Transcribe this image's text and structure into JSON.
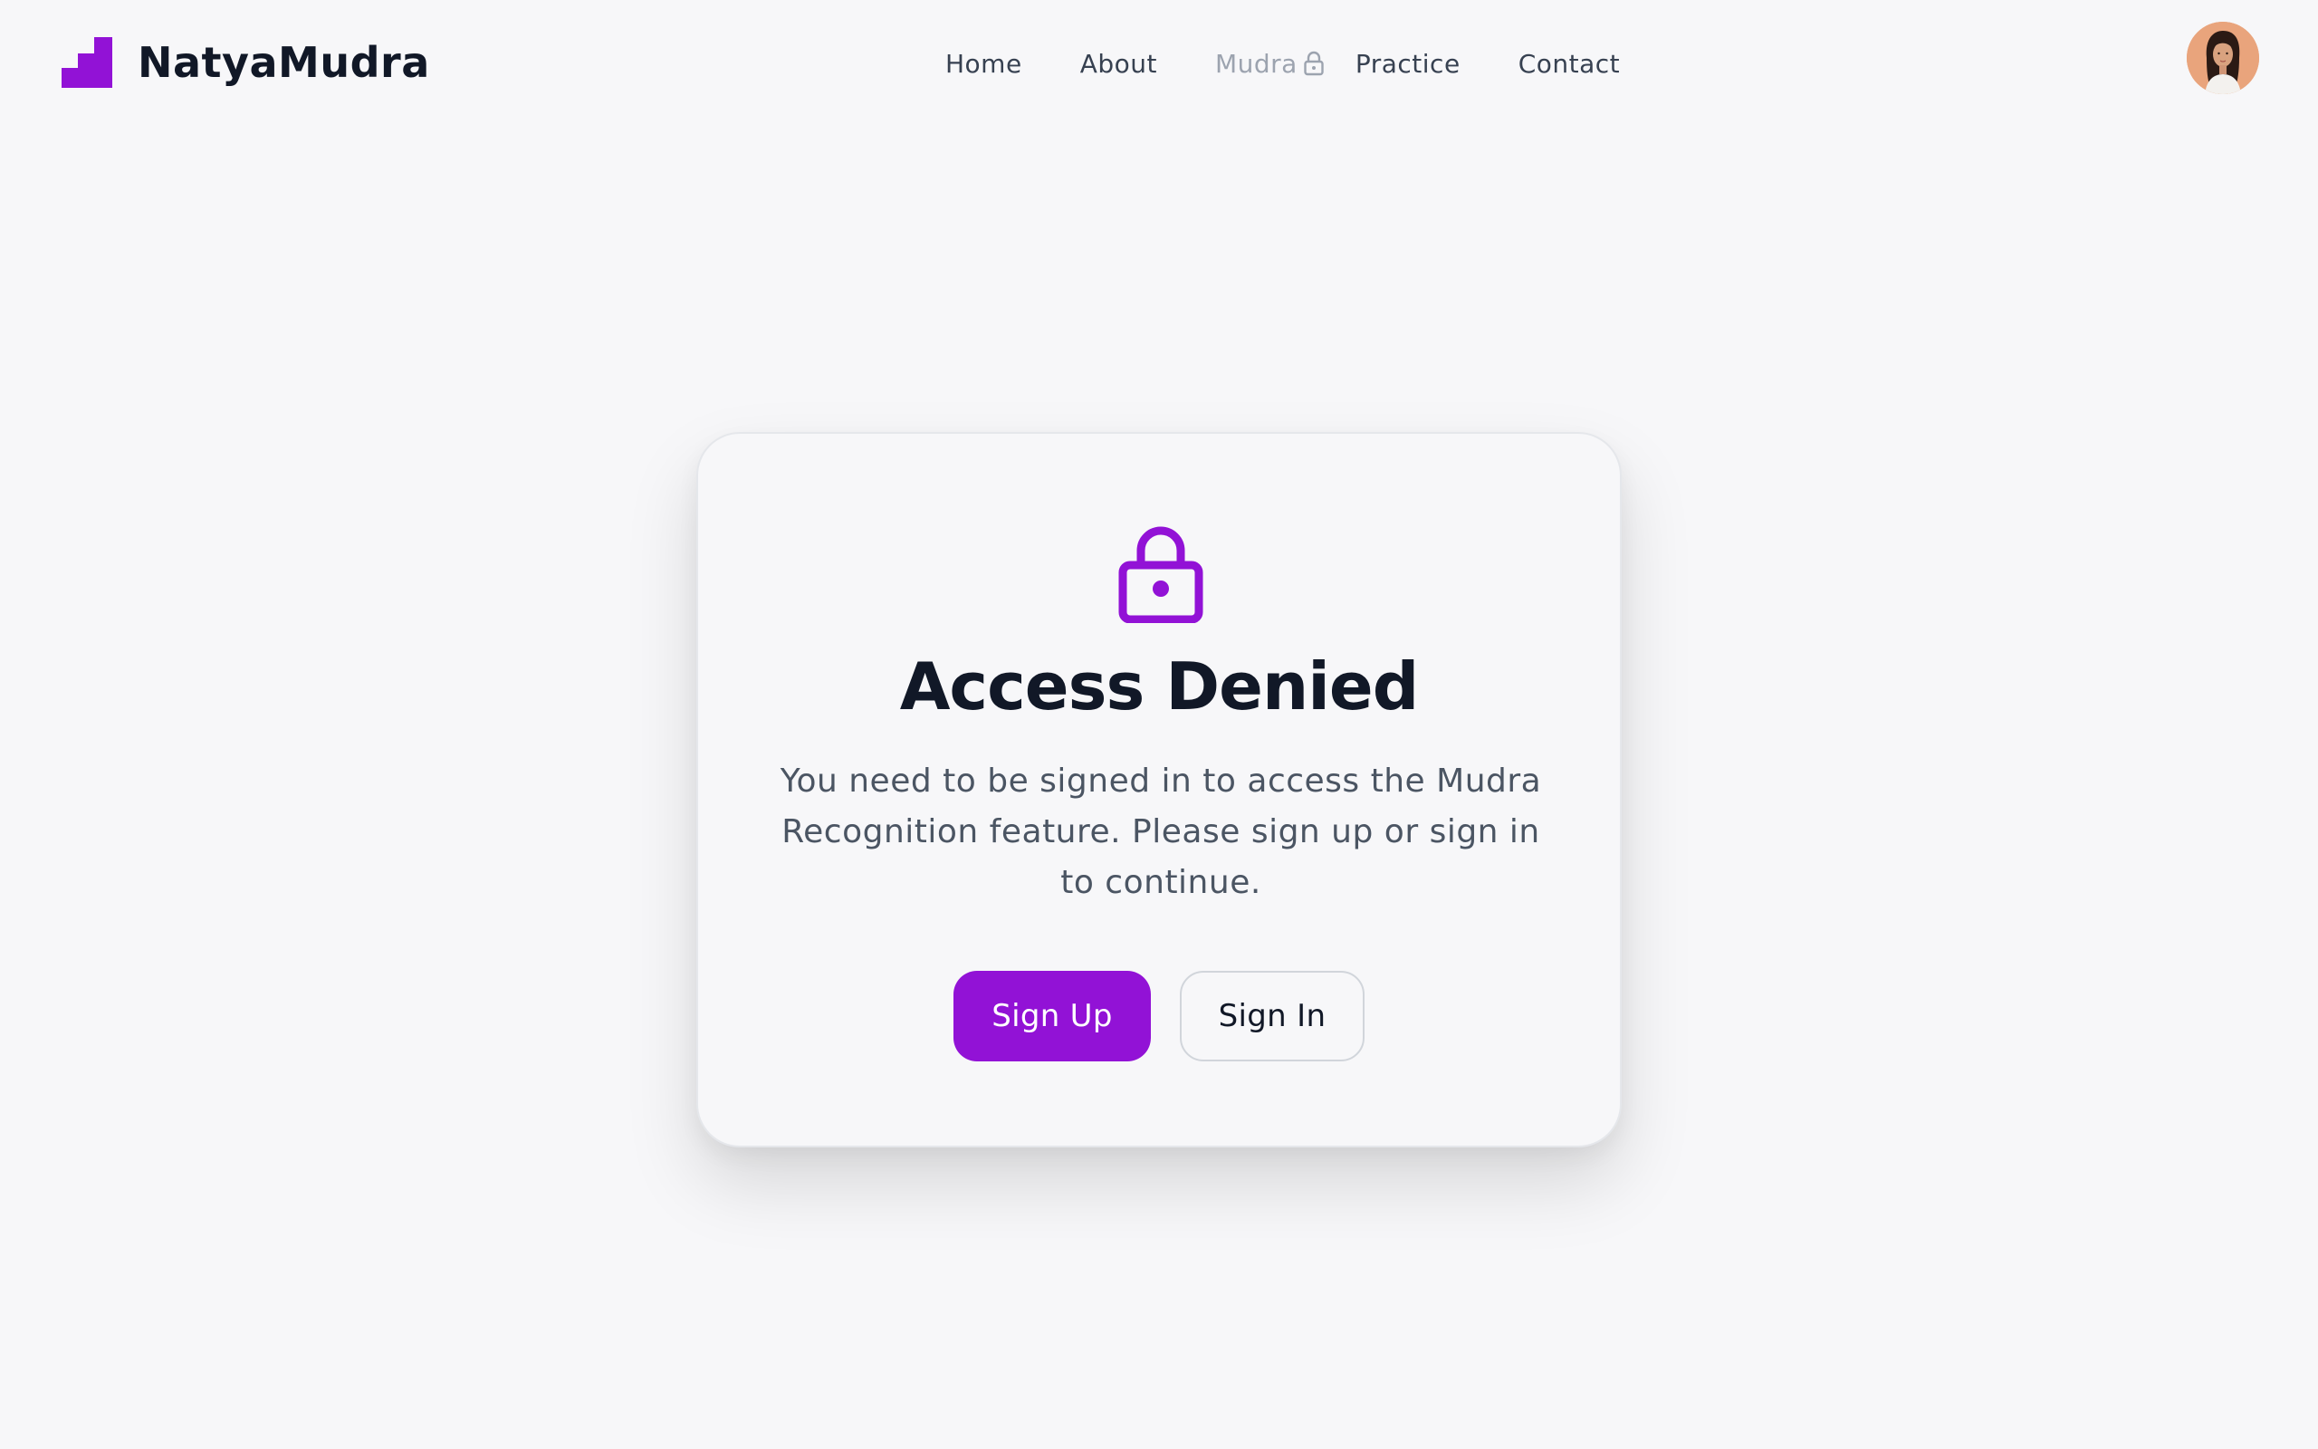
{
  "brand": {
    "name": "NatyaMudra",
    "accent_color": "#9212d6"
  },
  "nav": {
    "items": [
      {
        "label": "Home"
      },
      {
        "label": "About"
      },
      {
        "label": "Mudra",
        "locked": true
      },
      {
        "label": "Practice"
      },
      {
        "label": "Contact"
      }
    ]
  },
  "user": {
    "avatar_icon": "user-avatar-photo"
  },
  "card": {
    "icon": "lock-icon",
    "title": "Access Denied",
    "message": "You need to be signed in to access the Mudra Recognition feature. Please sign up or sign in to continue.",
    "primary_button": "Sign Up",
    "secondary_button": "Sign In"
  }
}
